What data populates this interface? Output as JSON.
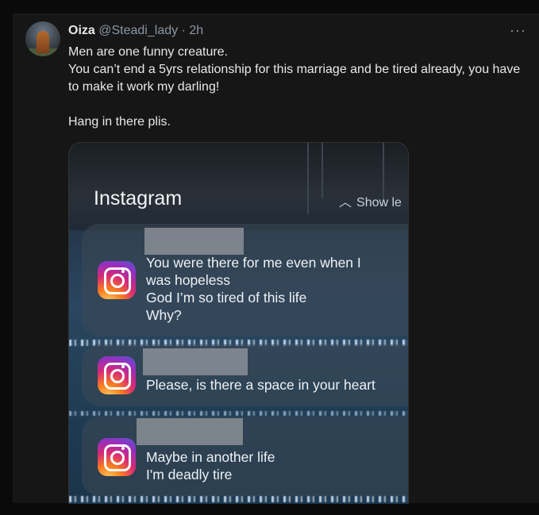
{
  "tweet": {
    "author_name": "Oiza",
    "handle": "@Steadi_lady",
    "separator": "·",
    "time": "2h",
    "more": "···",
    "lines": [
      "Men are one funny creature.",
      "You can’t end a 5yrs relationship for this marriage and be tired already, you have to make it work my darling!"
    ],
    "closing": "Hang in there plis."
  },
  "media": {
    "app_title": "Instagram",
    "show_less": "Show le",
    "notifications": [
      {
        "lines": [
          "You were there for me even when I",
          "was hopeless",
          "God I’m so tired of this life",
          "Why?"
        ]
      },
      {
        "lines": [
          "Please, is there a space in your heart"
        ]
      },
      {
        "lines": [
          "Maybe in another life",
          "I'm deadly tire"
        ]
      }
    ]
  },
  "icons": {
    "app": "instagram-icon",
    "chevron": "chevron-up-icon",
    "more": "more-icon"
  }
}
